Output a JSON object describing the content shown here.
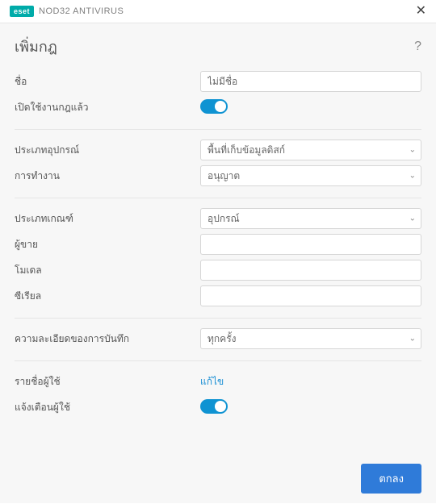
{
  "app": {
    "brand_badge": "eset",
    "brand_name": "NOD32 ANTIVIRUS"
  },
  "page": {
    "title": "เพิ่มกฎ",
    "help_symbol": "?"
  },
  "fields": {
    "name": {
      "label": "ชื่อ",
      "value": "ไม่มีชื่อ"
    },
    "enabled": {
      "label": "เปิดใช้งานกฎแล้ว",
      "on": true
    },
    "device_type": {
      "label": "ประเภทอุปกรณ์",
      "value": "พื้นที่เก็บข้อมูลดิสก์"
    },
    "action": {
      "label": "การทำงาน",
      "value": "อนุญาต"
    },
    "criteria_type": {
      "label": "ประเภทเกณฑ์",
      "value": "อุปกรณ์"
    },
    "vendor": {
      "label": "ผู้ขาย",
      "value": ""
    },
    "model": {
      "label": "โมเดล",
      "value": ""
    },
    "serial": {
      "label": "ซีเรียล",
      "value": ""
    },
    "log_severity": {
      "label": "ความละเอียดของการบันทึก",
      "value": "ทุกครั้ง"
    },
    "user_list": {
      "label": "รายชื่อผู้ใช้",
      "link": "แก้ไข"
    },
    "notify": {
      "label": "แจ้งเตือนผู้ใช้",
      "on": true
    }
  },
  "buttons": {
    "ok": "ตกลง"
  }
}
